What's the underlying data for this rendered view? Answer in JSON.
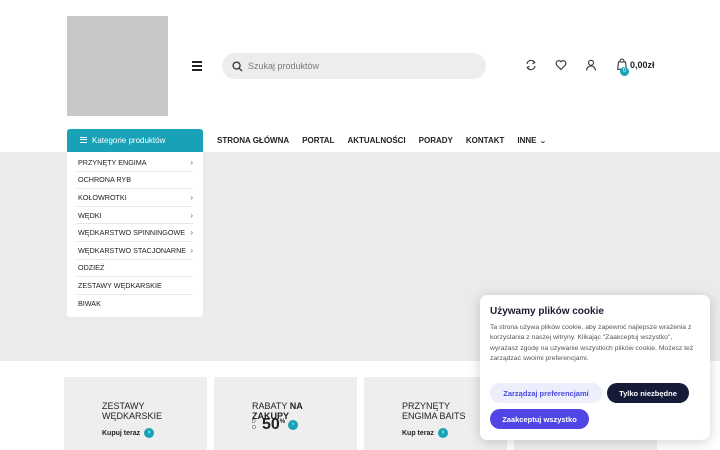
{
  "header": {
    "search_placeholder": "Szukaj produktów",
    "cart_count": "0",
    "cart_total": "0,00zł",
    "icons": [
      "menu-icon",
      "search-icon",
      "compare-icon",
      "heart-icon",
      "user-icon",
      "cart-icon"
    ]
  },
  "nav": {
    "categories_button": "Kategorie produktów",
    "menu": [
      {
        "label": "STRONA GŁÓWNA"
      },
      {
        "label": "PORTAL"
      },
      {
        "label": "AKTUALNOŚCI"
      },
      {
        "label": "PORADY"
      },
      {
        "label": "KONTAKT"
      },
      {
        "label": "INNE"
      }
    ]
  },
  "categories": [
    {
      "label": "PRZYNĘTY ENGIMA",
      "has_sub": true
    },
    {
      "label": "OCHRONA RYB",
      "has_sub": false
    },
    {
      "label": "KOŁOWROTKI",
      "has_sub": true
    },
    {
      "label": "WĘDKI",
      "has_sub": true
    },
    {
      "label": "WĘDKARSTWO SPINNINGOWE",
      "has_sub": true
    },
    {
      "label": "WĘDKARSTWO STACJONARNE",
      "has_sub": true
    },
    {
      "label": "ODZIEŻ",
      "has_sub": false
    },
    {
      "label": "ZESTAWY WĘDKARSKIE",
      "has_sub": false
    },
    {
      "label": "BIWAK",
      "has_sub": false
    }
  ],
  "promos": {
    "card1": {
      "title_line1": "ZESTAWY",
      "title_line2": "WĘDKARSKIE",
      "link": "Kupuj teraz"
    },
    "card2": {
      "title_light": "RABATY",
      "title_bold": "NA",
      "title_line2": "ZAKUPY",
      "do_1": "D",
      "do_2": "O",
      "percent": "50",
      "percent_sign": "%"
    },
    "card3": {
      "title_line1": "PRZYNĘTY",
      "title_line2": "ENGIMA BAITS",
      "link": "Kup teraz"
    }
  },
  "cookie": {
    "title": "Używamy plików cookie",
    "text": "Ta strona używa plików cookie, aby zapewnić najlepsze wrażenia z korzystania z naszej witryny. Klikając \"Zaakceptuj wszystko\", wyrażasz zgodę na używanie wszystkich plików cookie. Możesz też zarządzać swoimi preferencjami.",
    "manage_button": "Zarządzaj preferencjami",
    "necessary_button": "Tylko niezbędne",
    "accept_button": "Zaakceptuj wszystko"
  },
  "colors": {
    "accent": "#17a2b8",
    "cookie_primary": "#4f46e5",
    "cookie_dark": "#151a36"
  }
}
